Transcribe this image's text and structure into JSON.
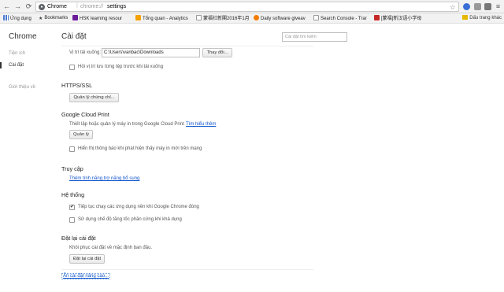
{
  "toolbar": {
    "site_label": "Chrome",
    "url_host": "chrome://",
    "url_path": "settings"
  },
  "bookmarks": [
    {
      "label": "Ứng dụng",
      "color": "#4a7bd0"
    },
    {
      "label": "Bookmarks",
      "color": "#444444"
    },
    {
      "label": "HSK learning resour",
      "color": "#6a1b9a"
    },
    {
      "label": "Tổng quan - Analytics",
      "color": "#f4a100"
    },
    {
      "label": "蒙福社新閣2016年1月",
      "color": "#888888"
    },
    {
      "label": "Daily software giveav",
      "color": "#f57c00"
    },
    {
      "label": "Search Console - Trar",
      "color": "#888888"
    },
    {
      "label": "[蒙福]新汉语小学母",
      "color": "#c62828"
    }
  ],
  "bookmarks_right": "Dấu trang khác",
  "nav": {
    "app_title": "Chrome",
    "items": [
      {
        "label": "Tiện ích"
      },
      {
        "label": "Cài đặt"
      },
      {
        "label": "Giới thiệu về"
      }
    ]
  },
  "main": {
    "title": "Cài đặt",
    "search_placeholder": "Cài đặt tìm kiếm",
    "downloads": {
      "location_label": "Vị trí tải xuống:",
      "location_value": "C:\\Users\\vanbac\\Downloads",
      "change_button": "Thay đổi...",
      "ask_label": "Hỏi vị trí lưu từng tệp trước khi tải xuống"
    },
    "https": {
      "heading": "HTTPS/SSL",
      "manage_button": "Quản lý chứng chỉ..."
    },
    "cloud_print": {
      "heading": "Google Cloud Print",
      "description": "Thiết lập hoặc quản lý máy in trong Google Cloud Print",
      "learn_more": "Tìm hiểu thêm",
      "manage_button": "Quản lý",
      "notify_label": "Hiển thị thông báo khi phát hiện thấy máy in mới trên mạng"
    },
    "accessibility": {
      "heading": "Truy cập",
      "add_link": "Thêm tính năng trợ năng bổ sung"
    },
    "system": {
      "heading": "Hệ thống",
      "background_label": "Tiếp tục chạy các ứng dụng nền khi Google Chrome đóng",
      "background_checked": true,
      "hw_accel_label": "Sử dụng chế độ tăng tốc phần cứng khi khả dụng",
      "hw_accel_checked": false
    },
    "reset": {
      "heading": "Đặt lại cài đặt",
      "description": "Khôi phục cài đặt về mặc định ban đầu.",
      "button": "Đặt lại cài đặt"
    },
    "hide_advanced": "Ẩn cài đặt nâng cao..."
  }
}
